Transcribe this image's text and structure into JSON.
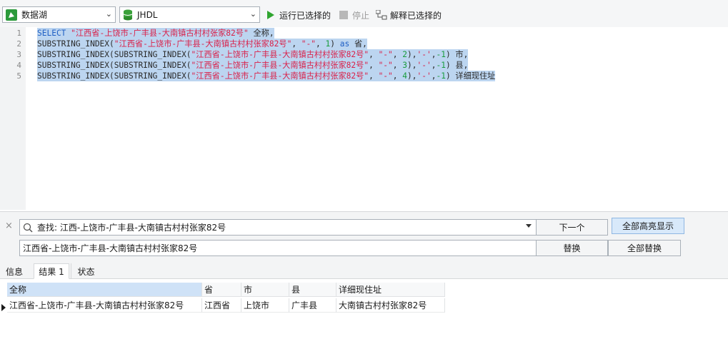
{
  "toolbar": {
    "connection": "数据湖",
    "database": "JHDL",
    "run_selected": "运行已选择的",
    "stop": "停止",
    "explain_selected": "解释已选择的",
    "colors": {
      "run": "#2fa52f",
      "db": "#3aa03a",
      "conn": "#2b9a3b"
    }
  },
  "editor": {
    "line_numbers": [
      "1",
      "2",
      "3",
      "4",
      "5"
    ],
    "lines": [
      [
        {
          "t": "kw",
          "v": "SELECT"
        },
        {
          "t": "txt",
          "v": " "
        },
        {
          "t": "str",
          "v": "\"江西省-上饶市-广丰县-大南镇古村村张家82号\""
        },
        {
          "t": "txt",
          "v": " 全称,"
        }
      ],
      [
        {
          "t": "txt",
          "v": "SUBSTRING_INDEX("
        },
        {
          "t": "str",
          "v": "\"江西省-上饶市-广丰县-大南镇古村村张家82号\""
        },
        {
          "t": "txt",
          "v": ", "
        },
        {
          "t": "str",
          "v": "\"-\""
        },
        {
          "t": "txt",
          "v": ", "
        },
        {
          "t": "num",
          "v": "1"
        },
        {
          "t": "txt",
          "v": ") "
        },
        {
          "t": "kw",
          "v": "as"
        },
        {
          "t": "txt",
          "v": " 省,"
        }
      ],
      [
        {
          "t": "txt",
          "v": "SUBSTRING_INDEX(SUBSTRING_INDEX("
        },
        {
          "t": "str",
          "v": "\"江西省-上饶市-广丰县-大南镇古村村张家82号\""
        },
        {
          "t": "txt",
          "v": ", "
        },
        {
          "t": "str",
          "v": "\"-\""
        },
        {
          "t": "txt",
          "v": ", "
        },
        {
          "t": "num",
          "v": "2"
        },
        {
          "t": "txt",
          "v": "),"
        },
        {
          "t": "str",
          "v": "'-'"
        },
        {
          "t": "txt",
          "v": ","
        },
        {
          "t": "num",
          "v": "-1"
        },
        {
          "t": "txt",
          "v": ") 市,"
        }
      ],
      [
        {
          "t": "txt",
          "v": "SUBSTRING_INDEX(SUBSTRING_INDEX("
        },
        {
          "t": "str",
          "v": "\"江西省-上饶市-广丰县-大南镇古村村张家82号\""
        },
        {
          "t": "txt",
          "v": ", "
        },
        {
          "t": "str",
          "v": "\"-\""
        },
        {
          "t": "txt",
          "v": ", "
        },
        {
          "t": "num",
          "v": "3"
        },
        {
          "t": "txt",
          "v": "),"
        },
        {
          "t": "str",
          "v": "'-'"
        },
        {
          "t": "txt",
          "v": ","
        },
        {
          "t": "num",
          "v": "-1"
        },
        {
          "t": "txt",
          "v": ") 县,"
        }
      ],
      [
        {
          "t": "txt",
          "v": "SUBSTRING_INDEX(SUBSTRING_INDEX("
        },
        {
          "t": "str",
          "v": "\"江西省-上饶市-广丰县-大南镇古村村张家82号\""
        },
        {
          "t": "txt",
          "v": ", "
        },
        {
          "t": "str",
          "v": "\"-\""
        },
        {
          "t": "txt",
          "v": ", "
        },
        {
          "t": "num",
          "v": "4"
        },
        {
          "t": "txt",
          "v": "),"
        },
        {
          "t": "str",
          "v": "'-'"
        },
        {
          "t": "txt",
          "v": ","
        },
        {
          "t": "num",
          "v": "-1"
        },
        {
          "t": "txt",
          "v": ") 详细现住址"
        }
      ]
    ],
    "colors": {
      "keyword": "#1f5fc4",
      "string": "#d9214a",
      "number": "#1a9c3d",
      "selection": "#bcd5f0"
    }
  },
  "find": {
    "search_value": "查找: 江西-上饶市-广丰县-大南镇古村村张家82号",
    "replace_value": "江西省-上饶市-广丰县-大南镇古村村张家82号",
    "next_label": "下一个",
    "highlight_all_label": "全部高亮显示",
    "replace_label": "替换",
    "replace_all_label": "全部替换"
  },
  "tabs": [
    "信息",
    "结果 1",
    "状态"
  ],
  "active_tab": "结果 1",
  "results": {
    "columns": [
      "全称",
      "省",
      "市",
      "县",
      "详细现住址"
    ],
    "rows": [
      [
        "江西省-上饶市-广丰县-大南镇古村村张家82号",
        "江西省",
        "上饶市",
        "广丰县",
        "大南镇古村村张家82号"
      ]
    ]
  }
}
